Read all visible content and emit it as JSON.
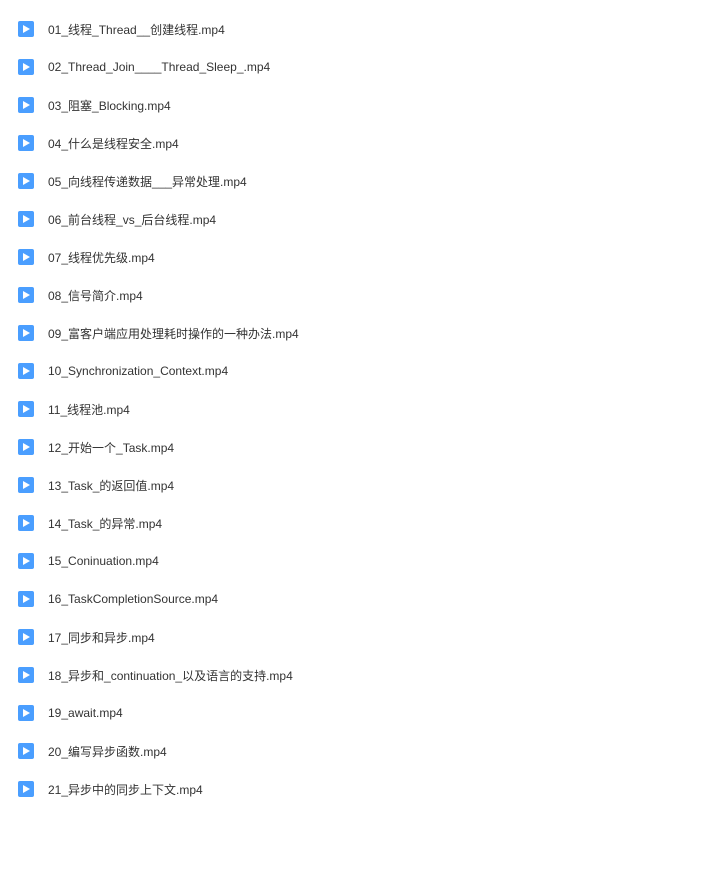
{
  "files": [
    {
      "name": "01_线程_Thread__创建线程.mp4"
    },
    {
      "name": "02_Thread_Join____Thread_Sleep_.mp4"
    },
    {
      "name": "03_阻塞_Blocking.mp4"
    },
    {
      "name": "04_什么是线程安全.mp4"
    },
    {
      "name": "05_向线程传递数据___异常处理.mp4"
    },
    {
      "name": "06_前台线程_vs_后台线程.mp4"
    },
    {
      "name": "07_线程优先级.mp4"
    },
    {
      "name": "08_信号简介.mp4"
    },
    {
      "name": "09_富客户端应用处理耗时操作的一种办法.mp4"
    },
    {
      "name": "10_Synchronization_Context.mp4"
    },
    {
      "name": "11_线程池.mp4"
    },
    {
      "name": "12_开始一个_Task.mp4"
    },
    {
      "name": "13_Task_的返回值.mp4"
    },
    {
      "name": "14_Task_的异常.mp4"
    },
    {
      "name": "15_Coninuation.mp4"
    },
    {
      "name": "16_TaskCompletionSource.mp4"
    },
    {
      "name": "17_同步和异步.mp4"
    },
    {
      "name": "18_异步和_continuation_以及语言的支持.mp4"
    },
    {
      "name": "19_await.mp4"
    },
    {
      "name": "20_编写异步函数.mp4"
    },
    {
      "name": "21_异步中的同步上下文.mp4"
    }
  ]
}
